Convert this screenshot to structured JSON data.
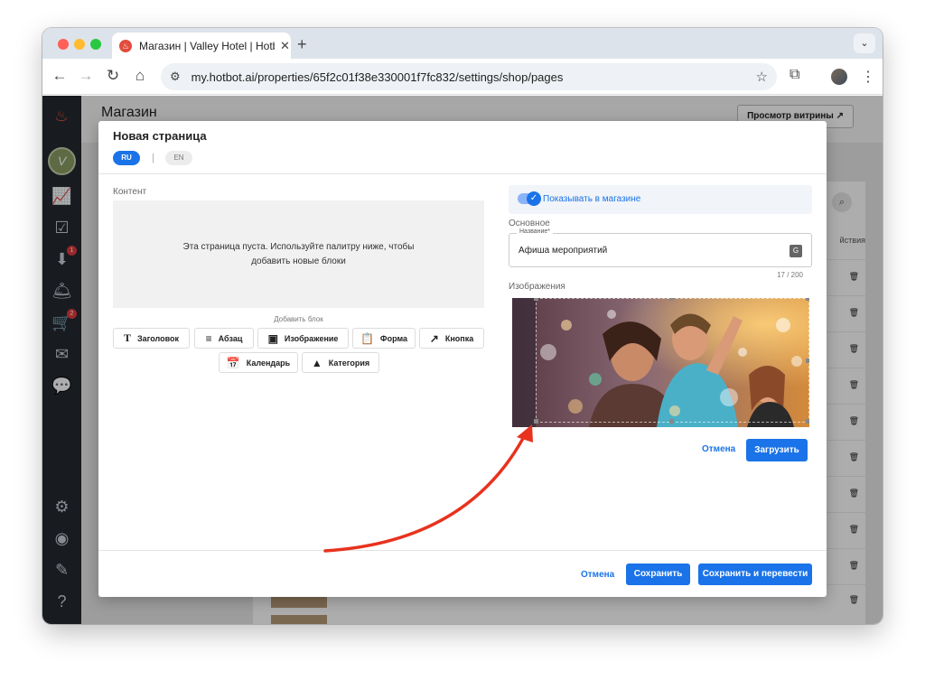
{
  "browser": {
    "tab_title": "Магазин | Valley Hotel | Hotbot",
    "tab_close": "✕",
    "new_tab": "+",
    "url": "my.hotbot.ai/properties/65f2c01f38e330001f7fc832/settings/shop/pages"
  },
  "sidebar": {
    "badges": {
      "inbox": "1",
      "cart": "2"
    }
  },
  "page": {
    "title": "Магазин",
    "storefront_button": "Просмотр витрины ↗",
    "bg_actions_header": "йствия"
  },
  "modal": {
    "title": "Новая страница",
    "lang_ru": "RU",
    "lang_en": "EN",
    "content_label": "Контент",
    "empty_text": "Эта страница пуста. Используйте палитру ниже, чтобы добавить новые блоки",
    "add_block_label": "Добавить блок",
    "blocks": [
      {
        "label": "Заголовок",
        "icon": "title-icon"
      },
      {
        "label": "Абзац",
        "icon": "paragraph-icon"
      },
      {
        "label": "Изображение",
        "icon": "image-icon"
      },
      {
        "label": "Форма",
        "icon": "form-icon"
      },
      {
        "label": "Кнопка",
        "icon": "link-icon"
      },
      {
        "label": "Календарь",
        "icon": "calendar-icon"
      },
      {
        "label": "Категория",
        "icon": "category-icon"
      }
    ],
    "show_in_shop": "Показывать в магазине",
    "basic_label": "Основное",
    "name_field_label": "Название*",
    "name_value": "Афиша мероприятий",
    "char_count": "17 / 200",
    "images_label": "Изображения",
    "image_cancel": "Отмена",
    "image_upload": "Загрузить",
    "footer_cancel": "Отмена",
    "footer_save": "Сохранить",
    "footer_save_translate": "Сохранить и перевести"
  },
  "colors": {
    "accent": "#1a73e8",
    "sidebar_bg": "#242830",
    "annotation_arrow": "#e8321e"
  }
}
